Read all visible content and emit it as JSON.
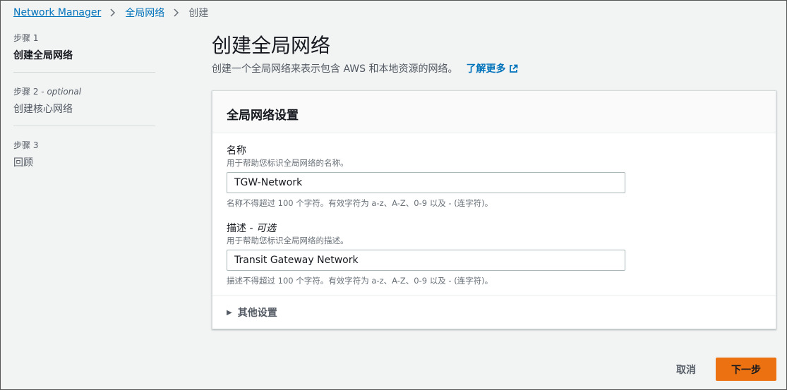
{
  "breadcrumb": {
    "items": [
      "Network Manager",
      "全局网络"
    ],
    "current": "创建"
  },
  "steps": [
    {
      "label": "步骤 1",
      "optional": "",
      "title": "创建全局网络"
    },
    {
      "label": "步骤 2 -",
      "optional": "optional",
      "title": "创建核心网络"
    },
    {
      "label": "步骤 3",
      "optional": "",
      "title": "回顾"
    }
  ],
  "page": {
    "title": "创建全局网络",
    "description": "创建一个全局网络来表示包含 AWS 和本地资源的网络。",
    "learn_more": "了解更多"
  },
  "panel": {
    "header": "全局网络设置",
    "name": {
      "label": "名称",
      "hint": "用于帮助您标识全局网络的名称。",
      "value": "TGW-Network",
      "constraint": "名称不得超过 100 个字符。有效字符为 a-z、A-Z、0-9 以及 - (连字符)。"
    },
    "description": {
      "label": "描述 -",
      "optional": "可选",
      "hint": "用于帮助您标识全局网络的描述。",
      "value": "Transit Gateway Network",
      "constraint": "描述不得超过 100 个字符。有效字符为 a-z、A-Z、0-9 以及 - (连字符)。"
    },
    "additional_settings": "其他设置"
  },
  "actions": {
    "cancel": "取消",
    "next": "下一步"
  },
  "colors": {
    "accent": "#0073bb",
    "primary_button": "#ec7211"
  },
  "icons": {
    "breadcrumb_separator": "chevron-right-icon",
    "learn_more": "external-link-icon",
    "expander": "caret-right-icon"
  }
}
